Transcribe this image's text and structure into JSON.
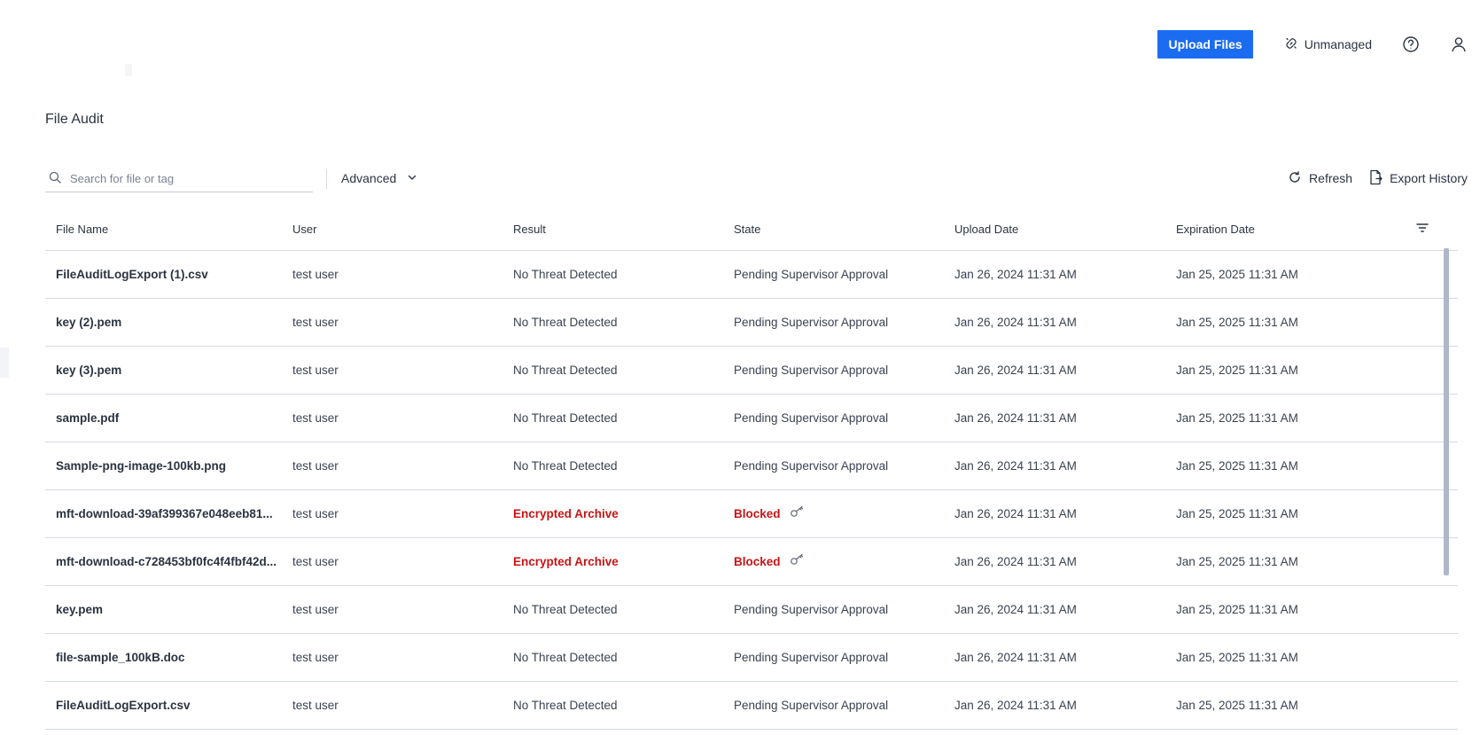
{
  "header": {
    "upload_label": "Upload Files",
    "unmanaged_label": "Unmanaged"
  },
  "page": {
    "title": "File Audit"
  },
  "toolbar": {
    "search_placeholder": "Search for file or tag",
    "advanced_label": "Advanced",
    "refresh_label": "Refresh",
    "export_label": "Export History"
  },
  "table": {
    "columns": [
      "File Name",
      "User",
      "Result",
      "State",
      "Upload Date",
      "Expiration Date"
    ],
    "rows": [
      {
        "name": "FileAuditLogExport (1).csv",
        "user": "test user",
        "result": "No Threat Detected",
        "state": "Pending Supervisor Approval",
        "upload": "Jan 26, 2024 11:31 AM",
        "expiration": "Jan 25, 2025 11:31 AM"
      },
      {
        "name": "key (2).pem",
        "user": "test user",
        "result": "No Threat Detected",
        "state": "Pending Supervisor Approval",
        "upload": "Jan 26, 2024 11:31 AM",
        "expiration": "Jan 25, 2025 11:31 AM"
      },
      {
        "name": "key (3).pem",
        "user": "test user",
        "result": "No Threat Detected",
        "state": "Pending Supervisor Approval",
        "upload": "Jan 26, 2024 11:31 AM",
        "expiration": "Jan 25, 2025 11:31 AM"
      },
      {
        "name": "sample.pdf",
        "user": "test user",
        "result": "No Threat Detected",
        "state": "Pending Supervisor Approval",
        "upload": "Jan 26, 2024 11:31 AM",
        "expiration": "Jan 25, 2025 11:31 AM"
      },
      {
        "name": "Sample-png-image-100kb.png",
        "user": "test user",
        "result": "No Threat Detected",
        "state": "Pending Supervisor Approval",
        "upload": "Jan 26, 2024 11:31 AM",
        "expiration": "Jan 25, 2025 11:31 AM"
      },
      {
        "name": "mft-download-39af399367e048eeb81...",
        "user": "test user",
        "result": "Encrypted Archive",
        "state": "Blocked",
        "upload": "Jan 26, 2024 11:31 AM",
        "expiration": "Jan 25, 2025 11:31 AM"
      },
      {
        "name": "mft-download-c728453bf0fc4f4fbf42d...",
        "user": "test user",
        "result": "Encrypted Archive",
        "state": "Blocked",
        "upload": "Jan 26, 2024 11:31 AM",
        "expiration": "Jan 25, 2025 11:31 AM"
      },
      {
        "name": "key.pem",
        "user": "test user",
        "result": "No Threat Detected",
        "state": "Pending Supervisor Approval",
        "upload": "Jan 26, 2024 11:31 AM",
        "expiration": "Jan 25, 2025 11:31 AM"
      },
      {
        "name": "file-sample_100kB.doc",
        "user": "test user",
        "result": "No Threat Detected",
        "state": "Pending Supervisor Approval",
        "upload": "Jan 26, 2024 11:31 AM",
        "expiration": "Jan 25, 2025 11:31 AM"
      },
      {
        "name": "FileAuditLogExport.csv",
        "user": "test user",
        "result": "No Threat Detected",
        "state": "Pending Supervisor Approval",
        "upload": "Jan 26, 2024 11:31 AM",
        "expiration": "Jan 25, 2025 11:31 AM"
      }
    ]
  },
  "colors": {
    "primary": "#1c6cf2",
    "danger": "#c81414",
    "text": "#2b3340",
    "divider": "#d6dae1"
  },
  "icons": [
    "link-icon",
    "help-icon",
    "user-icon",
    "search-icon",
    "chevron-down-icon",
    "refresh-icon",
    "export-icon",
    "filter-icon",
    "key-icon"
  ]
}
